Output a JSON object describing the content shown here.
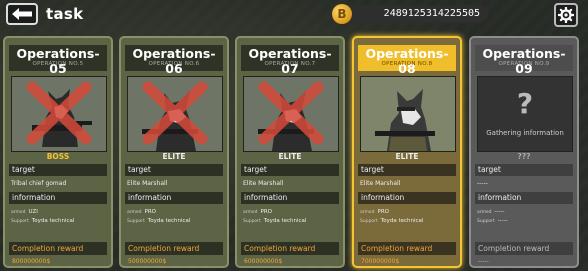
{
  "header": {
    "title": "task",
    "back_icon": "back-arrow-icon",
    "coin_icon": "bitcoin-icon",
    "coin_symbol": "B",
    "coin_value": "2489125314225505",
    "settings_icon": "gear-icon"
  },
  "operations": [
    {
      "name": "Operations-05",
      "code": "OPERATION NO.5",
      "rank": "BOSS",
      "completed": true,
      "target_label": "target",
      "target": "Tribal chief gomad",
      "info_label": "information",
      "armed_key": "armed",
      "armed": "UZI",
      "support_key": "Support",
      "support": "Toyda technical",
      "reward_label": "Completion reward",
      "reward": "800000000$"
    },
    {
      "name": "Operations-06",
      "code": "OPERATION NO.6",
      "rank": "ELITE",
      "completed": true,
      "target_label": "target",
      "target": "Elite Marshall",
      "info_label": "information",
      "armed_key": "armed",
      "armed": "PRO",
      "support_key": "Support",
      "support": "Toyda technical",
      "reward_label": "Completion reward",
      "reward": "500000000$"
    },
    {
      "name": "Operations-07",
      "code": "OPERATION NO.7",
      "rank": "ELITE",
      "completed": true,
      "target_label": "target",
      "target": "Elite Marshall",
      "info_label": "information",
      "armed_key": "armed",
      "armed": "PRO",
      "support_key": "Support",
      "support": "Toyda technical",
      "reward_label": "Completion reward",
      "reward": "600000000$"
    },
    {
      "name": "Operations-08",
      "code": "OPERATION NO.8",
      "rank": "ELITE",
      "completed": false,
      "target_label": "target",
      "target": "Elite Marshall",
      "info_label": "information",
      "armed_key": "armed",
      "armed": "PRO",
      "support_key": "Support",
      "support": "Toyda technical",
      "reward_label": "Completion reward",
      "reward": "700000000$"
    },
    {
      "name": "Operations-09",
      "code": "OPERATION NO.9",
      "rank": "???",
      "locked": true,
      "question": "?",
      "gathering": "Gathering information",
      "target_label": "target",
      "target": "-----",
      "info_label": "information",
      "armed_key": "armed",
      "armed": "-----",
      "support_key": "Support",
      "support": "-----",
      "reward_label": "Completion reward",
      "reward": "-----"
    }
  ],
  "colors": {
    "card_bg": "#5d6445",
    "active_border": "#f4c431",
    "reward_text": "#f0a63a",
    "completed_cross": "#d64a3a"
  }
}
